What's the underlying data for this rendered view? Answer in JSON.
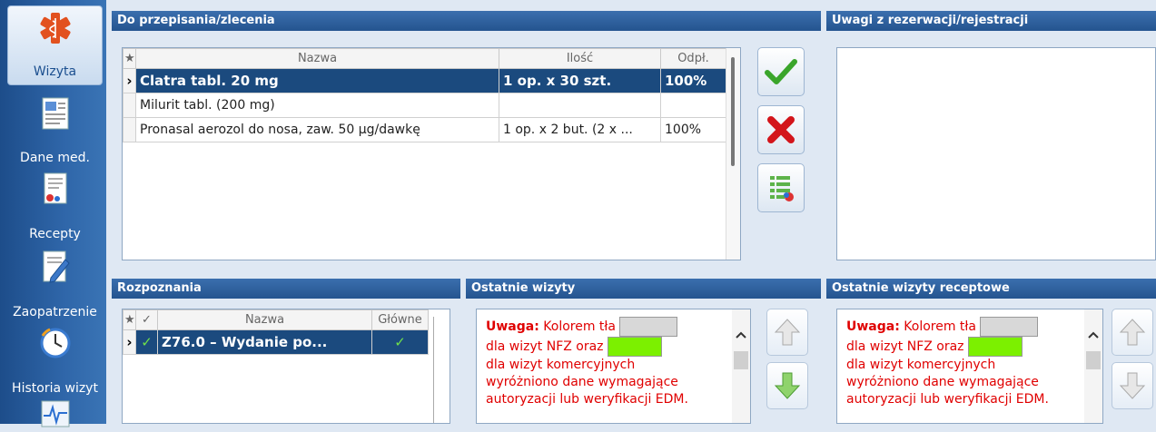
{
  "sidebar": {
    "items": [
      {
        "label": "Wizyta",
        "icon": "medical-star-icon",
        "active": true
      },
      {
        "label": "Dane med.",
        "icon": "medical-record-icon",
        "active": false
      },
      {
        "label": "Recepty",
        "icon": "prescription-icon",
        "active": false
      },
      {
        "label": "Zaopatrzenie",
        "icon": "supply-document-icon",
        "active": false
      },
      {
        "label": "Historia wizyt",
        "icon": "history-clock-icon",
        "active": false
      },
      {
        "label": "",
        "icon": "ecg-icon",
        "active": false
      }
    ]
  },
  "orders": {
    "title": "Do przepisania/zlecenia",
    "columns": [
      "★",
      "Nazwa",
      "Ilość",
      "Odpł."
    ],
    "rows": [
      {
        "name": "Clatra tabl. 20 mg",
        "qty": "1 op. x 30 szt.",
        "refund": "100%",
        "selected": true
      },
      {
        "name": "Milurit tabl. (200 mg)",
        "qty": "",
        "refund": "",
        "selected": false
      },
      {
        "name": "Pronasal aerozol do nosa, zaw. 50 µg/dawkę",
        "qty": "1 op. x 2 but. (2 x ...",
        "refund": "100%",
        "selected": false
      }
    ]
  },
  "remarks": {
    "title": "Uwagi z rezerwacji/rejestracji",
    "value": ""
  },
  "diagnoses": {
    "title": "Rozpoznania",
    "columns": [
      "★",
      "✓",
      "Nazwa",
      "Główne"
    ],
    "rows": [
      {
        "name": "Z76.0 – Wydanie po...",
        "main": "✓",
        "checked": "✓",
        "selected": true
      }
    ]
  },
  "recent_visits": {
    "title": "Ostatnie wizyty",
    "notice": {
      "bold": "Uwaga:",
      "line1": " Kolorem tła",
      "line2": "dla wizyt NFZ oraz",
      "line3": "dla wizyt komercyjnych",
      "line4": "wyróżniono dane wymagające",
      "line5": "autoryzacji lub weryfikacji EDM."
    }
  },
  "recent_rx_visits": {
    "title": "Ostatnie wizyty receptowe",
    "notice": {
      "bold": "Uwaga:",
      "line1": " Kolorem tła",
      "line2": "dla wizyt NFZ oraz",
      "line3": "dla wizyt komercyjnych",
      "line4": "wyróżniono dane wymagające",
      "line5": "autoryzacji lub weryfikacji EDM."
    }
  },
  "colors": {
    "nfz_swatch": "#d8d8d8",
    "commercial_swatch": "#7cf000",
    "accent": "#24548f",
    "notice_text": "#e00000"
  }
}
